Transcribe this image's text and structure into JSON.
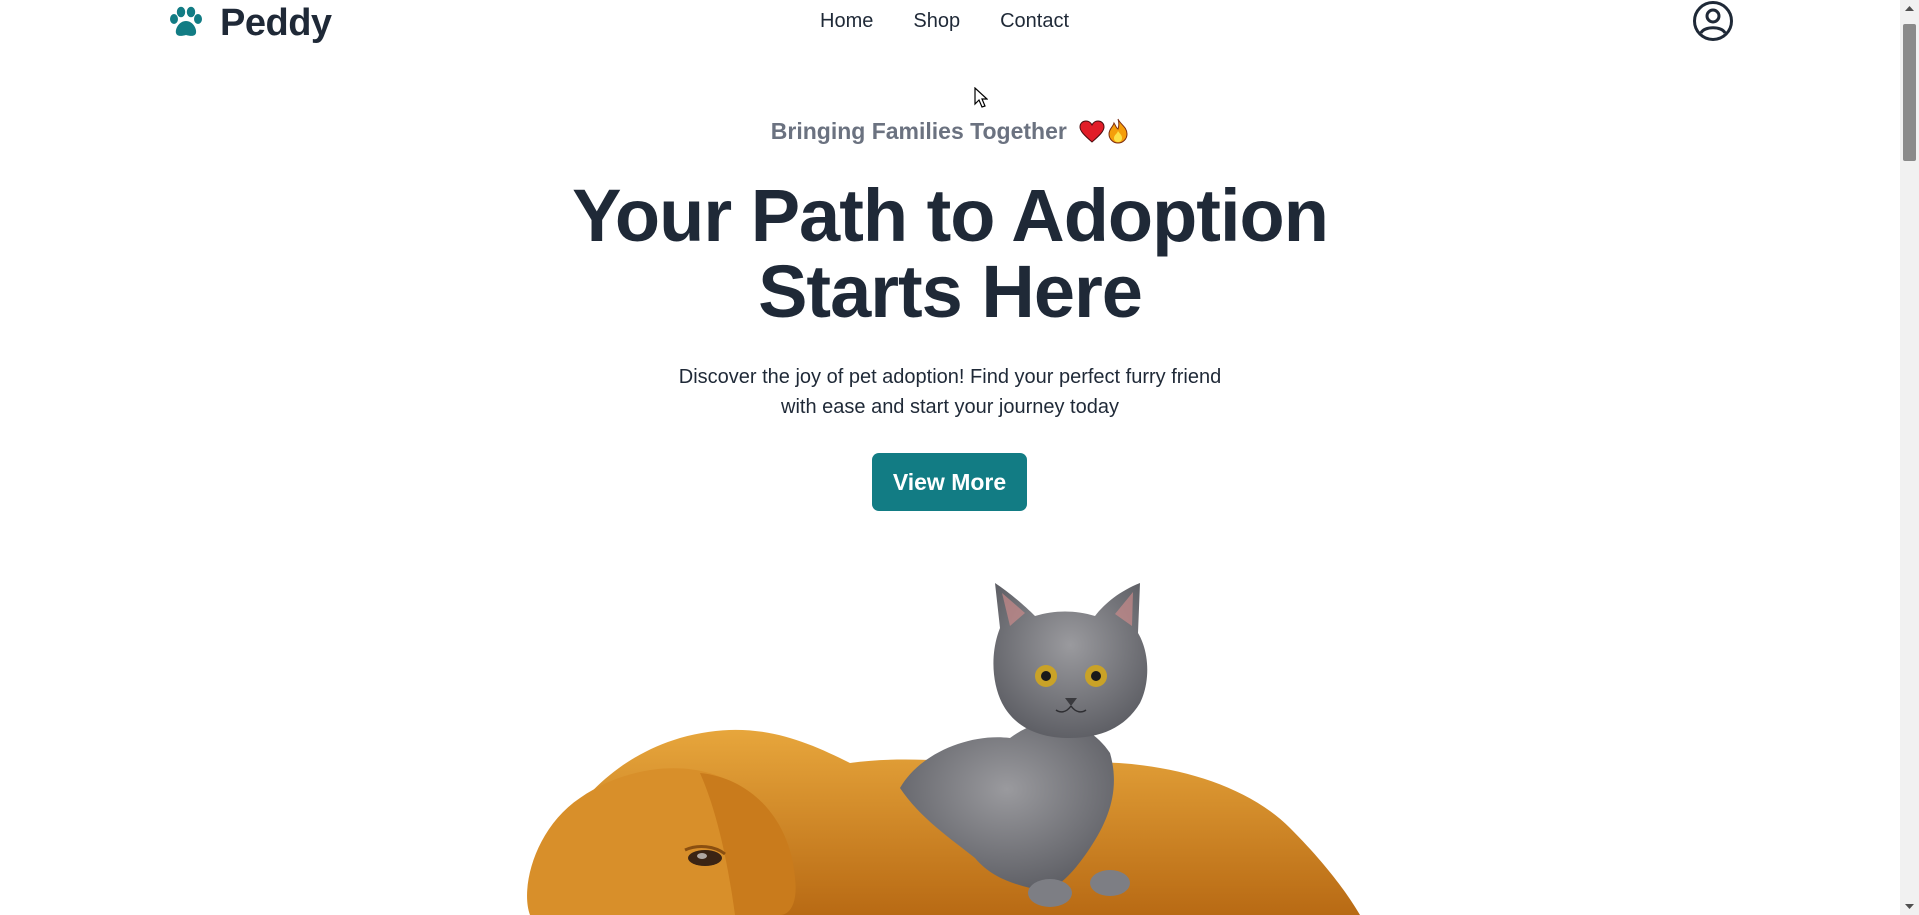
{
  "brand": {
    "name": "Peddy",
    "icon": "paw-icon",
    "accent": "#127c84"
  },
  "nav": {
    "items": [
      {
        "label": "Home"
      },
      {
        "label": "Shop"
      },
      {
        "label": "Contact"
      }
    ]
  },
  "header": {
    "account_icon": "user-circle-icon"
  },
  "hero": {
    "tagline": "Bringing Families Together",
    "tagline_icons": [
      "heart-icon",
      "fire-icon"
    ],
    "title_line1": "Your Path to Adoption",
    "title_line2": "Starts Here",
    "description_line1": "Discover the joy of pet adoption! Find your perfect furry friend",
    "description_line2": "with ease and start your journey today",
    "cta_label": "View More",
    "image": "golden-retriever-with-gray-kitten"
  },
  "colors": {
    "text": "#1f2937",
    "muted": "#6b7280",
    "button": "#127c84"
  }
}
